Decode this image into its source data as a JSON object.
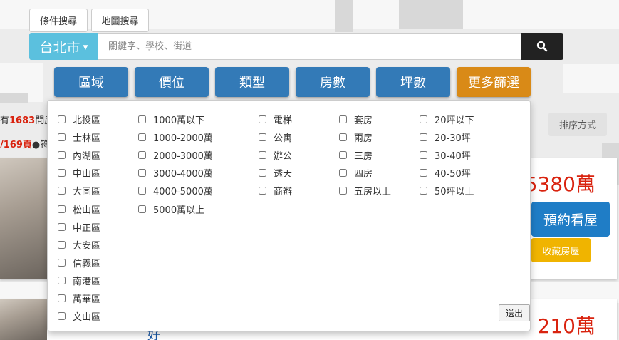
{
  "tabs": [
    "條件搜尋",
    "地圖搜尋"
  ],
  "search": {
    "city": "台北市",
    "placeholder": "關鍵字、學校、街道"
  },
  "filters": [
    "區域",
    "價位",
    "類型",
    "房數",
    "坪數",
    "更多篩選"
  ],
  "left_info": {
    "count_prefix": "有",
    "count": "1683",
    "count_suffix": "間房",
    "page": "/169頁",
    "page_suffix": "●符"
  },
  "sort_label": "排序方式",
  "listings": [
    {
      "price": "5380萬",
      "book_label": "預約看屋",
      "fav_label": "收藏房屋"
    },
    {
      "price": "210萬",
      "title_fragment": "好"
    }
  ],
  "options": {
    "district": [
      "北投區",
      "士林區",
      "內湖區",
      "中山區",
      "大同區",
      "松山區",
      "中正區",
      "大安區",
      "信義區",
      "南港區",
      "萬華區",
      "文山區"
    ],
    "price": [
      "1000萬以下",
      "1000-2000萬",
      "2000-3000萬",
      "3000-4000萬",
      "4000-5000萬",
      "5000萬以上"
    ],
    "type": [
      "電梯",
      "公寓",
      "辦公",
      "透天",
      "商辦"
    ],
    "rooms": [
      "套房",
      "兩房",
      "三房",
      "四房",
      "五房以上"
    ],
    "size": [
      "20坪以下",
      "20-30坪",
      "30-40坪",
      "40-50坪",
      "50坪以上"
    ]
  },
  "submit_label": "送出",
  "colors": {
    "city_button": "#5bc0de",
    "filter_button": "#337ab7",
    "more_button": "#d98a17",
    "price": "#d9230f",
    "book_button": "#1f7dc6",
    "fav_button": "#f0b400"
  }
}
